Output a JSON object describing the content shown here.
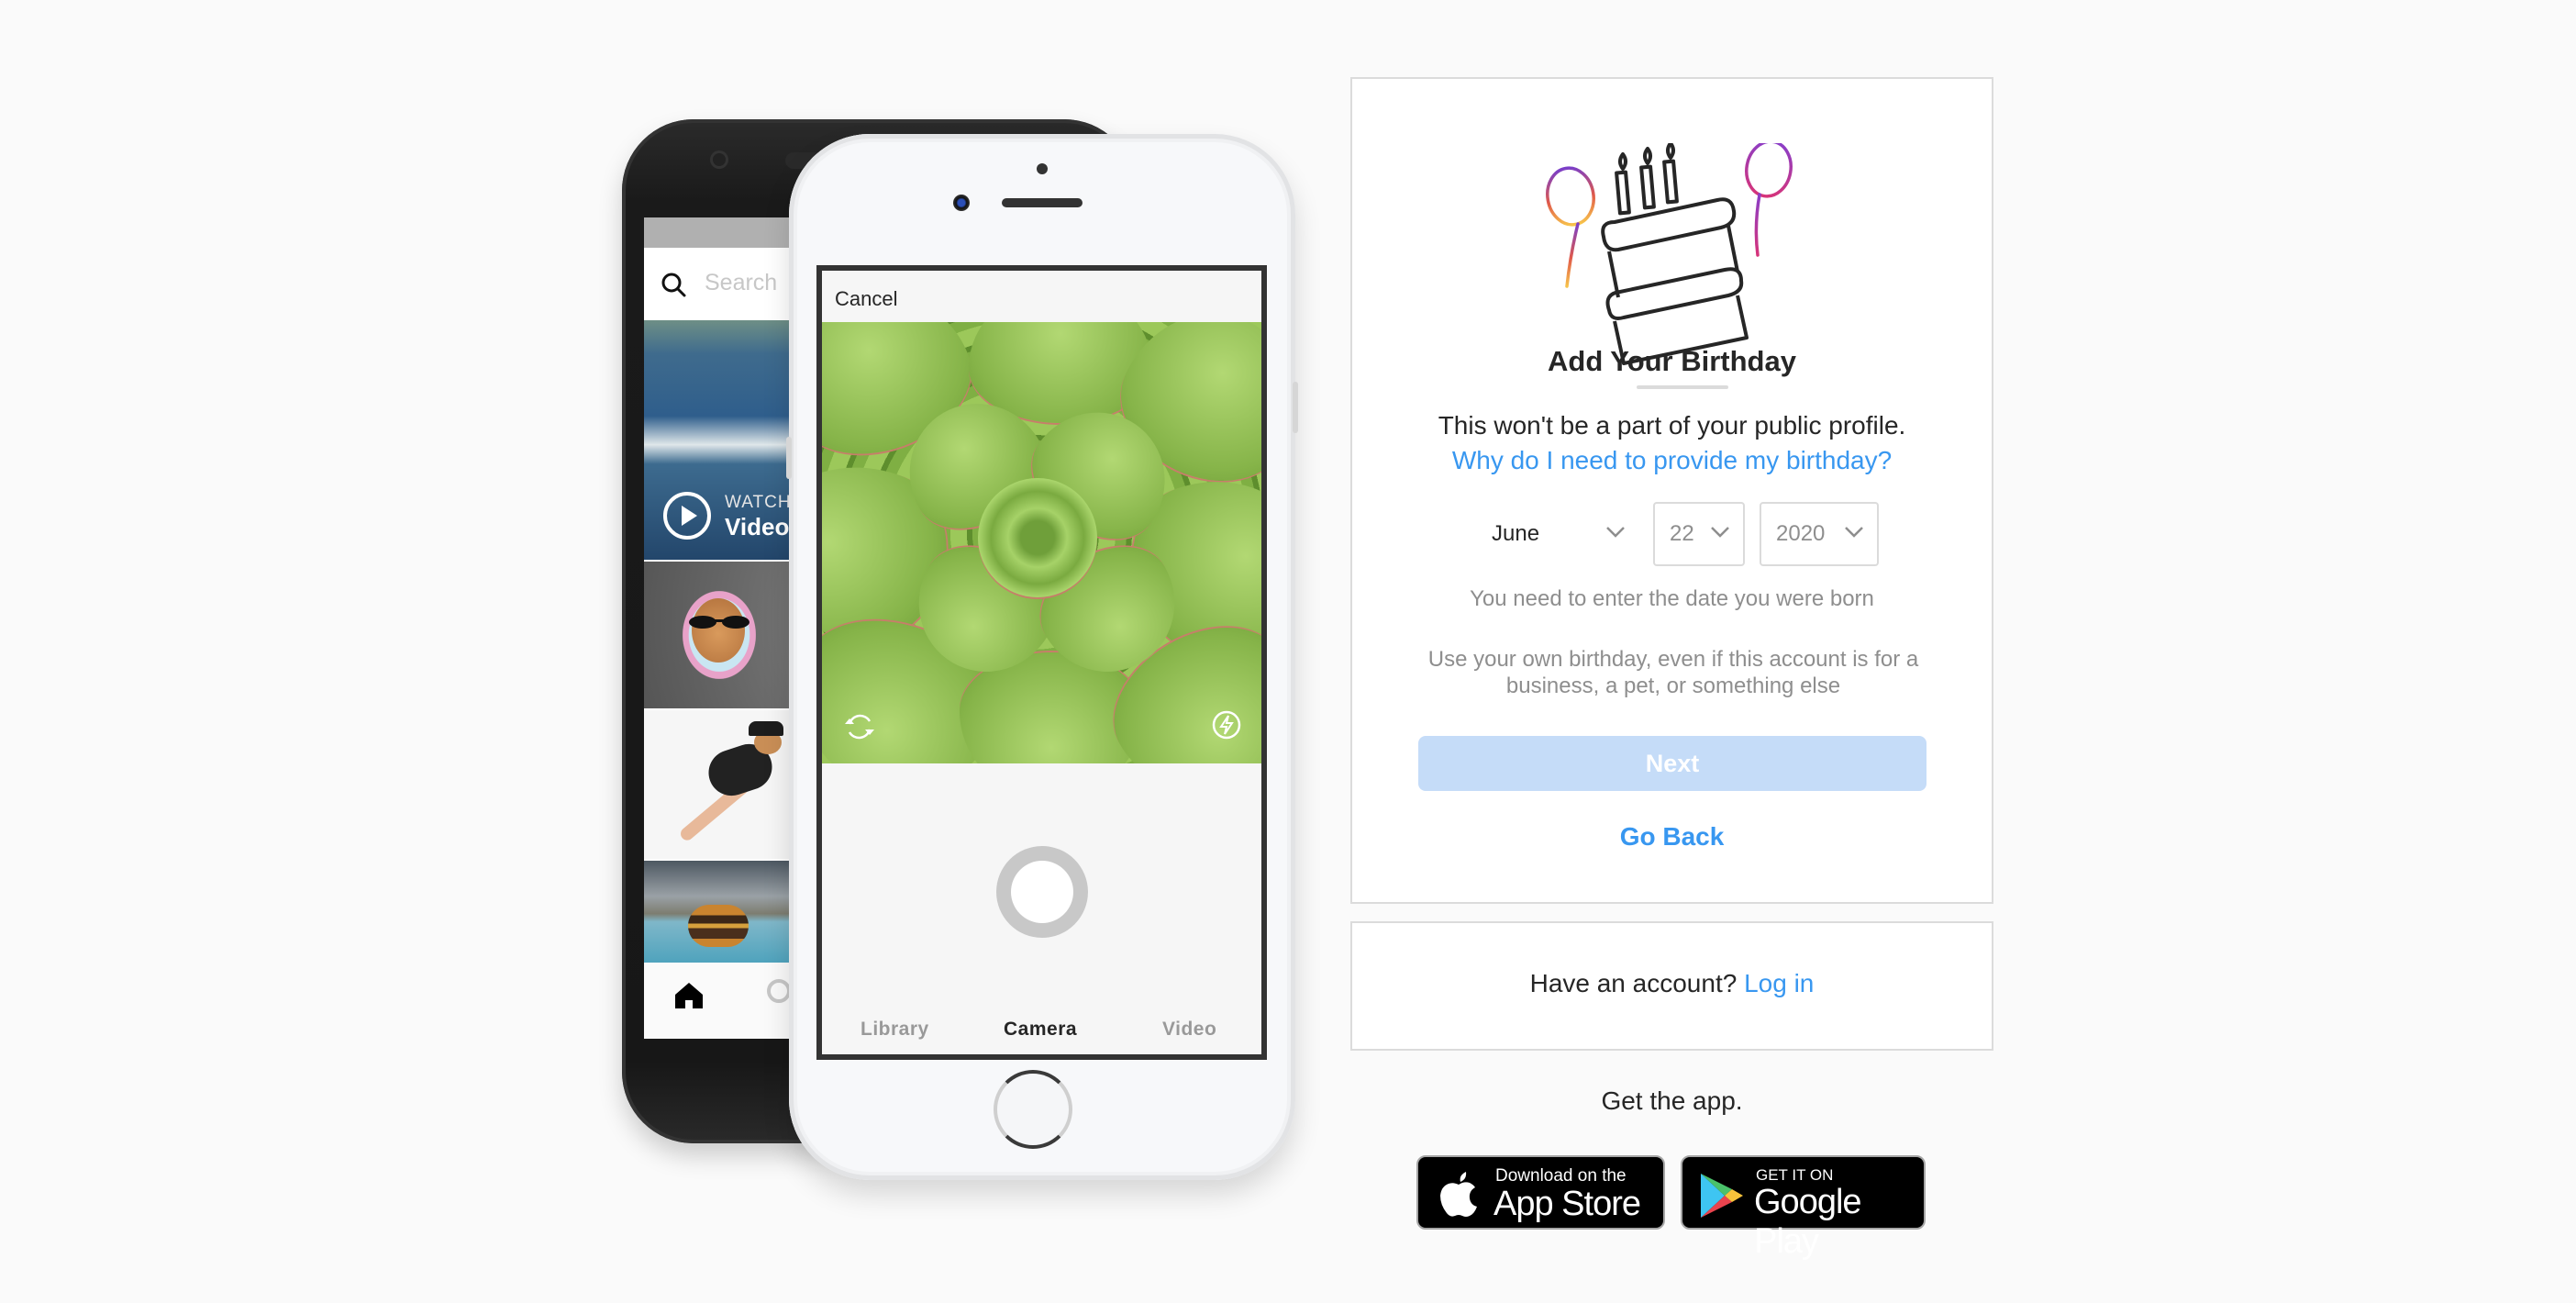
{
  "phones": {
    "android": {
      "search_placeholder": "Search",
      "video_overlay_kicker": "WATCH",
      "video_overlay_title": "Video"
    },
    "iphone": {
      "cancel_label": "Cancel",
      "tabs": [
        {
          "label": "Library",
          "active": false
        },
        {
          "label": "Camera",
          "active": true
        },
        {
          "label": "Video",
          "active": false
        }
      ]
    }
  },
  "birthday_card": {
    "title": "Add Your Birthday",
    "subtitle": "This won't be a part of your public profile.",
    "why_link": "Why do I need to provide my birthday?",
    "month": {
      "value": "June"
    },
    "day": {
      "value": "22"
    },
    "year": {
      "value": "2020"
    },
    "hint": "You need to enter the date you were born",
    "note": "Use your own birthday, even if this account is for a business, a pet, or something else",
    "next_label": "Next",
    "go_back_label": "Go Back"
  },
  "login_card": {
    "prompt": "Have an account?",
    "link": "Log in"
  },
  "get_app": {
    "label": "Get the app.",
    "app_store": {
      "small": "Download on the",
      "big": "App Store"
    },
    "google_play": {
      "small": "GET IT ON",
      "big": "Google Play"
    }
  },
  "colors": {
    "link_blue": "#3897f0",
    "next_disabled": "#c5dcf8",
    "card_border": "#dbdbdb",
    "page_bg": "#fafafa"
  }
}
